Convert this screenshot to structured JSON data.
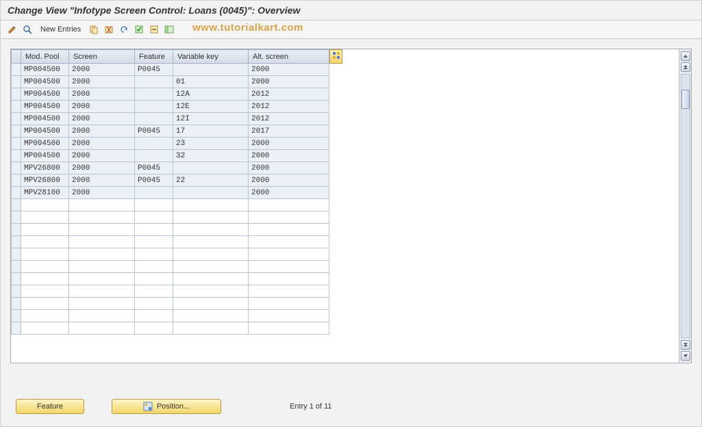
{
  "title": "Change View \"Infotype Screen Control: Loans (0045)\": Overview",
  "watermark": "www.tutorialkart.com",
  "toolbar": {
    "new_entries_label": "New Entries"
  },
  "columns": {
    "modpool": "Mod. Pool",
    "screen": "Screen",
    "feature": "Feature",
    "varkey": "Variable key",
    "altscreen": "Alt. screen"
  },
  "rows": [
    {
      "modpool": "MP004500",
      "screen": "2000",
      "feature": "P0045",
      "varkey": "",
      "altscreen": "2000"
    },
    {
      "modpool": "MP004500",
      "screen": "2000",
      "feature": "",
      "varkey": "01",
      "altscreen": "2000"
    },
    {
      "modpool": "MP004500",
      "screen": "2000",
      "feature": "",
      "varkey": "12A",
      "altscreen": "2012"
    },
    {
      "modpool": "MP004500",
      "screen": "2000",
      "feature": "",
      "varkey": "12E",
      "altscreen": "2012"
    },
    {
      "modpool": "MP004500",
      "screen": "2000",
      "feature": "",
      "varkey": "12I",
      "altscreen": "2012"
    },
    {
      "modpool": "MP004500",
      "screen": "2000",
      "feature": "P0045",
      "varkey": "17",
      "altscreen": "2017"
    },
    {
      "modpool": "MP004500",
      "screen": "2000",
      "feature": "",
      "varkey": "23",
      "altscreen": "2000"
    },
    {
      "modpool": "MP004500",
      "screen": "2000",
      "feature": "",
      "varkey": "32",
      "altscreen": "2000"
    },
    {
      "modpool": "MPV26800",
      "screen": "2000",
      "feature": "P0045",
      "varkey": "",
      "altscreen": "2000"
    },
    {
      "modpool": "MPV26800",
      "screen": "2000",
      "feature": "P0045",
      "varkey": "22",
      "altscreen": "2000"
    },
    {
      "modpool": "MPV28100",
      "screen": "2000",
      "feature": "",
      "varkey": "",
      "altscreen": "2000"
    }
  ],
  "empty_rows": 11,
  "footer": {
    "feature_btn": "Feature",
    "position_btn": "Position...",
    "status": "Entry 1 of 11"
  }
}
